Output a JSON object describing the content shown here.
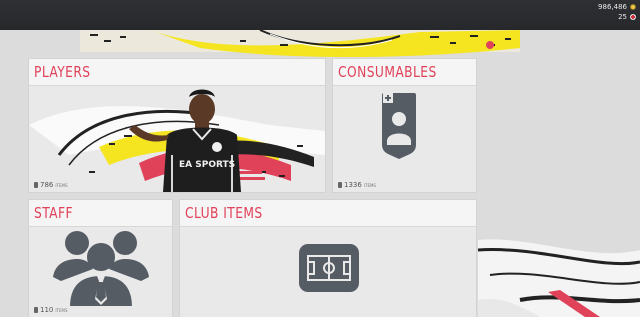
{
  "header": {
    "coins": "986,486",
    "points": "25",
    "coin_icon": "coins-icon",
    "points_icon": "fifa-points-icon"
  },
  "tiles": {
    "players": {
      "title": "PLAYERS",
      "count": "786",
      "unit": "ITEMS"
    },
    "consumables": {
      "title": "CONSUMABLES",
      "count": "1336",
      "unit": "ITEMS"
    },
    "staff": {
      "title": "STAFF",
      "count": "110",
      "unit": "ITEMS"
    },
    "club_items": {
      "title": "CLUB ITEMS"
    }
  },
  "player_shirt_sponsor": "EA SPORTS",
  "colors": {
    "accent": "#e0425a",
    "top_bar": "#2b2d30",
    "tile_bg": "#e9e9e9",
    "icon_gray": "#555c64"
  }
}
